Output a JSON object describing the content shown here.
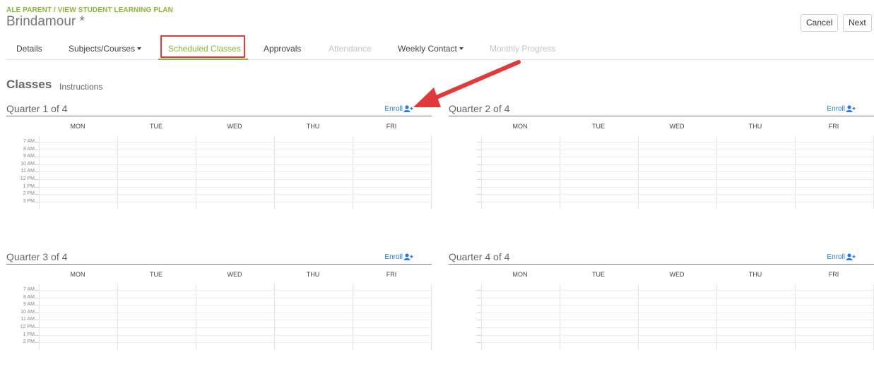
{
  "breadcrumb": "ALE PARENT / VIEW STUDENT LEARNING PLAN",
  "title": "Brindamour *",
  "buttons": {
    "cancel": "Cancel",
    "next": "Next"
  },
  "tabs": [
    {
      "label": "Details",
      "state": "normal"
    },
    {
      "label": "Subjects/Courses",
      "state": "normal",
      "dropdown": true
    },
    {
      "label": "Scheduled Classes",
      "state": "active"
    },
    {
      "label": "Approvals",
      "state": "normal"
    },
    {
      "label": "Attendance",
      "state": "disabled"
    },
    {
      "label": "Weekly Contact",
      "state": "normal",
      "dropdown": true
    },
    {
      "label": "Monthly Progress",
      "state": "disabled"
    }
  ],
  "section": {
    "title": "Classes",
    "link": "Instructions"
  },
  "enroll_label": "Enroll",
  "days": [
    "MON",
    "TUE",
    "WED",
    "THU",
    "FRI"
  ],
  "quarters": [
    {
      "title": "Quarter 1 of 4",
      "times": [
        "7 AM",
        "8 AM",
        "9 AM",
        "10 AM",
        "11 AM",
        "12 PM",
        "1 PM",
        "2 PM",
        "3 PM"
      ]
    },
    {
      "title": "Quarter 2 of 4",
      "times": [
        "",
        "",
        "",
        "",
        "",
        "",
        "",
        "",
        ""
      ]
    },
    {
      "title": "Quarter 3 of 4",
      "times": [
        "7 AM",
        "8 AM",
        "9 AM",
        "10 AM",
        "11 AM",
        "12 PM",
        "1 PM",
        "2 PM"
      ]
    },
    {
      "title": "Quarter 4 of 4",
      "times": [
        "",
        "",
        "",
        "",
        "",
        "",
        "",
        ""
      ]
    }
  ],
  "colors": {
    "accent": "#8cb43c",
    "link": "#2a7ad6",
    "annotation": "#e03a3a"
  }
}
